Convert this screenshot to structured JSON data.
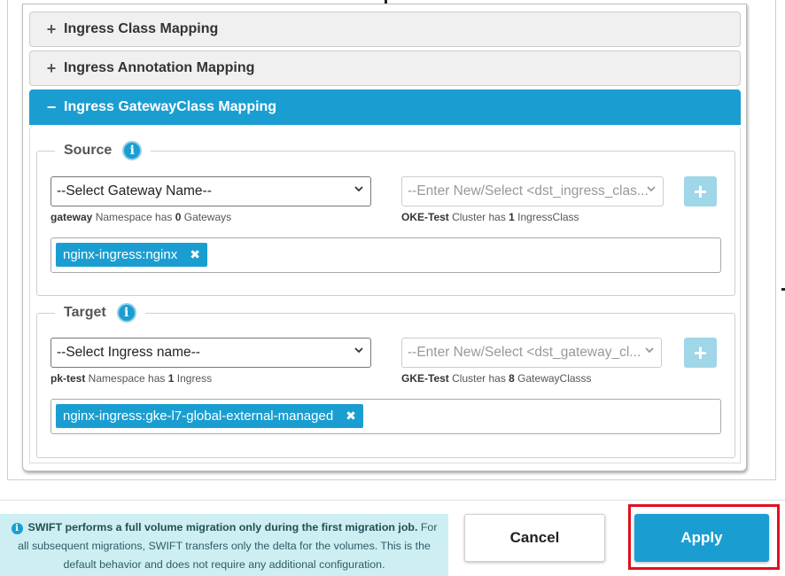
{
  "accordion": {
    "sections": [
      {
        "sign": "+",
        "label": "Ingress Class Mapping"
      },
      {
        "sign": "+",
        "label": "Ingress Annotation Mapping"
      },
      {
        "sign": "−",
        "label": "Ingress GatewayClass Mapping"
      }
    ]
  },
  "source": {
    "legend": "Source",
    "info": "i",
    "select_left": "--Select Gateway Name--",
    "select_right": "--Enter New/Select <dst_ingress_clas...",
    "add": "+",
    "hint_left": {
      "bold": "gateway",
      "pre": " Namespace has ",
      "count": "0",
      "post": " Gateways"
    },
    "hint_right": {
      "bold": "OKE-Test",
      "pre": " Cluster has ",
      "count": "1",
      "post": " IngressClass"
    },
    "tag": "nginx-ingress:nginx",
    "tag_remove": "✖"
  },
  "target": {
    "legend": "Target",
    "info": "i",
    "select_left": "--Select Ingress name--",
    "select_right": "--Enter New/Select <dst_gateway_cl...",
    "add": "+",
    "hint_left": {
      "bold": "pk-test",
      "pre": " Namespace has ",
      "count": "1",
      "post": " Ingress"
    },
    "hint_right": {
      "bold": "GKE-Test",
      "pre": " Cluster has ",
      "count": "8",
      "post": " GatewayClasss"
    },
    "tag": "nginx-ingress:gke-l7-global-external-managed",
    "tag_remove": "✖"
  },
  "notice": {
    "icon": "i",
    "bold": "SWIFT performs a full volume migration only during the first migration job.",
    "rest": " For all subsequent migrations, SWIFT transfers only the delta for the volumes. This is the default behavior and does not require any additional configuration."
  },
  "buttons": {
    "cancel": "Cancel",
    "apply": "Apply"
  },
  "colors": {
    "accent": "#1a9ed1",
    "highlight": "#e0101e"
  }
}
